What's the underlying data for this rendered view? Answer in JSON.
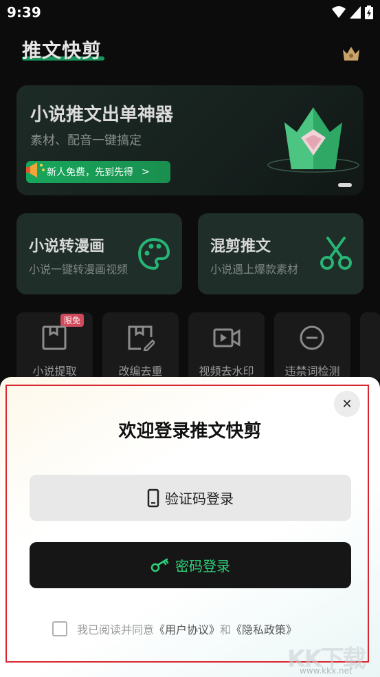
{
  "status": {
    "time": "9:39"
  },
  "header": {
    "title": "推文快剪"
  },
  "banner": {
    "title": "小说推文出单神器",
    "subtitle": "素材、配音一键搞定",
    "cta": "新人免费，先到先得",
    "cta_chevron": ">"
  },
  "cards": [
    {
      "title": "小说转漫画",
      "subtitle": "小说一键转漫画视频",
      "icon": "palette-icon"
    },
    {
      "title": "混剪推文",
      "subtitle": "小说遇上爆款素材",
      "icon": "scissors-icon"
    }
  ],
  "tools": [
    {
      "label": "小说提取",
      "badge": "限免",
      "icon": "book-icon"
    },
    {
      "label": "改编去重",
      "icon": "edit-book-icon"
    },
    {
      "label": "视频去水印",
      "icon": "video-icon"
    },
    {
      "label": "违禁词检测",
      "icon": "minus-circle-icon"
    }
  ],
  "login": {
    "title": "欢迎登录推文快剪",
    "code_login": "验证码登录",
    "password_login": "密码登录",
    "agree_prefix": "我已阅读并同意",
    "user_agreement": "《用户协议》",
    "and": "和",
    "privacy_policy": "《隐私政策》",
    "close_glyph": "✕"
  },
  "watermark": {
    "text": "KK下载",
    "url": "www.kkx.net"
  },
  "colors": {
    "accent_green": "#1fae6b",
    "highlight_red": "#d8262f"
  }
}
